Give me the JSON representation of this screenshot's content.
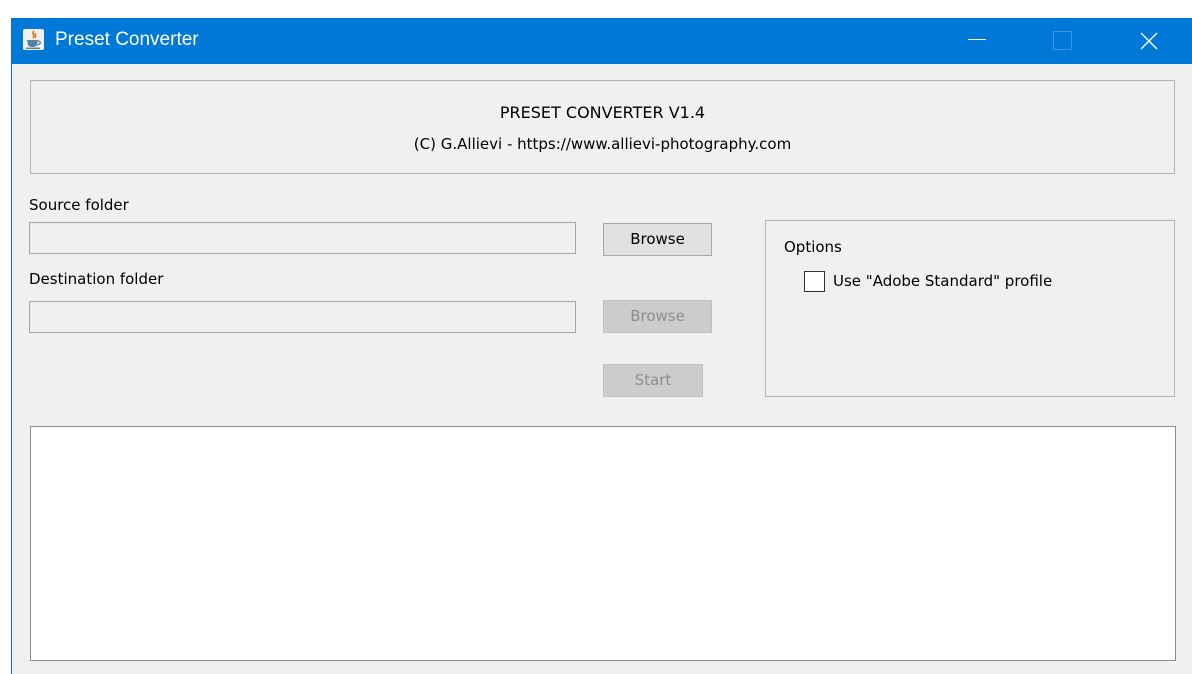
{
  "window": {
    "title": "Preset Converter",
    "title_bar_color": "#0078d7",
    "controls": [
      "minimize-icon",
      "maximize-icon",
      "close-icon"
    ],
    "app_icon": "java-cup-icon"
  },
  "header": {
    "title": "PRESET CONVERTER V1.4",
    "credit": "(C) G.Allievi - https://www.allievi-photography.com"
  },
  "source": {
    "label": "Source folder",
    "value": "",
    "browse_label": "Browse"
  },
  "destination": {
    "label": "Destination folder",
    "value": "",
    "browse_label": "Browse",
    "browse_enabled": false
  },
  "start": {
    "label": "Start",
    "enabled": false
  },
  "options": {
    "label": "Options",
    "adobe_standard": {
      "label": "Use \"Adobe Standard\" profile",
      "checked": false
    }
  },
  "log": {
    "text": ""
  }
}
